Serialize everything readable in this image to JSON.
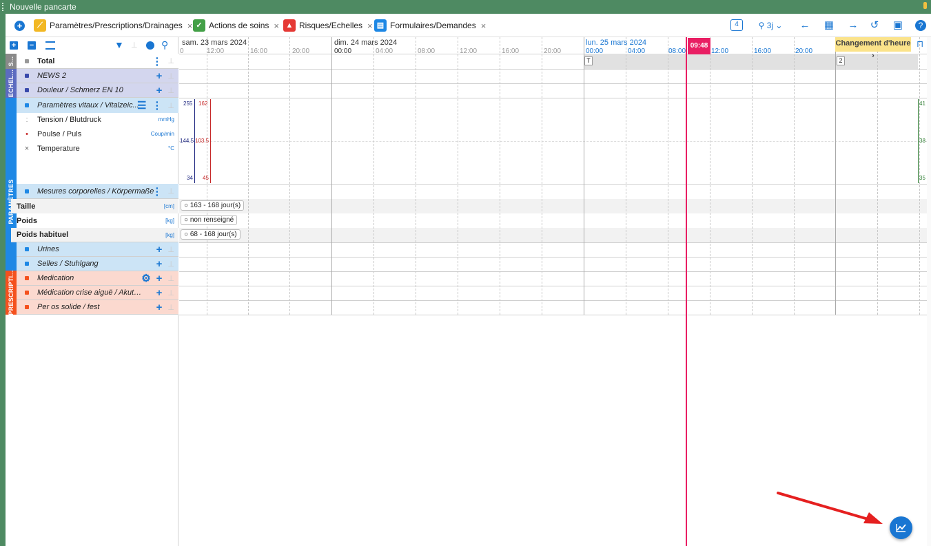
{
  "window": {
    "title": "Nouvelle pancarte"
  },
  "tabs": [
    {
      "label": "Paramètres/Prescriptions/Drainages",
      "color": "#f2b824"
    },
    {
      "label": "Actions de soins",
      "color": "#43a047"
    },
    {
      "label": "Risques/Echelles",
      "color": "#e53935"
    },
    {
      "label": "Formulaires/Demandes",
      "color": "#1e88e5"
    }
  ],
  "toolbar": {
    "badge": "4",
    "zoom": "3j",
    "colors": {
      "accent": "#1976d2"
    }
  },
  "sections": {
    "s": "S...",
    "echelles": "ECHEL...",
    "parametres": "PARAMÈTRES",
    "prescriptions": "PRESCRIPTI..."
  },
  "rows": {
    "total": "Total",
    "news2": "NEWS 2",
    "douleur": "Douleur / Schmerz EN 10",
    "parametres": "Paramètres vitaux / Vitalzeic...",
    "mesures": "Mesures corporelles / Körpermaße",
    "urines": "Urines",
    "selles": "Selles / Stuhlgang",
    "medication": "Medication",
    "medication_crise": "Médication crise aiguë / Akutmed...",
    "per_os": "Per os solide / fest"
  },
  "vitals": [
    {
      "label": "Tension / Blutdruck",
      "unit": "mmHg",
      "marker": "ː"
    },
    {
      "label": "Poulse / Puls",
      "unit": "Coup/min",
      "marker": "•"
    },
    {
      "label": "Temperature",
      "unit": "°C",
      "marker": "×"
    }
  ],
  "measures": [
    {
      "label": "Taille",
      "unit": "[cm]",
      "value": "○ 163 - 168 jour(s)"
    },
    {
      "label": "Poids",
      "unit": "[kg]",
      "value": "○ non renseigné"
    },
    {
      "label": "Poids habituel",
      "unit": "[kg]",
      "value": "○ 68 - 168 jour(s)"
    }
  ],
  "timeline": {
    "days": [
      "sam. 23 mars 2024",
      "dim. 24 mars 2024",
      "lun. 25 mars 2024"
    ],
    "hours_day1": [
      "0",
      "12:00",
      "16:00",
      "20:00"
    ],
    "hours_day2": [
      "00:00",
      "04:00",
      "08:00",
      "12:00",
      "16:00",
      "20:00"
    ],
    "hours_day3": [
      "00:00",
      "04:00",
      "08:00",
      "12:00",
      "16:00",
      "20:00"
    ],
    "now": "09:48",
    "changement": "Changement d'heure ›",
    "total_marker": "T",
    "second_marker": "2"
  },
  "scales": {
    "tension": [
      "255",
      "144.5",
      "34"
    ],
    "pulse": [
      "162",
      "103.5",
      "45"
    ],
    "temp": [
      "41",
      "38",
      "35"
    ]
  }
}
